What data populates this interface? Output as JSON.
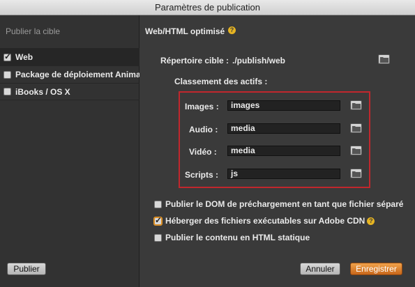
{
  "window": {
    "title": "Paramètres de publication"
  },
  "sidebar": {
    "title": "Publier la cible",
    "items": [
      {
        "label": "Web",
        "checked": true,
        "selected": true
      },
      {
        "label": "Package de déploiement Animate",
        "checked": false,
        "selected": false
      },
      {
        "label": "iBooks / OS X",
        "checked": false,
        "selected": false
      }
    ],
    "publish_button": "Publier"
  },
  "main": {
    "section_title": "Web/HTML optimisé",
    "target_dir_label": "Répertoire cible :",
    "target_dir_value": "./publish/web",
    "assets_title": "Classement des actifs :",
    "assets": [
      {
        "label": "Images :",
        "value": "images"
      },
      {
        "label": "Audio :",
        "value": "media"
      },
      {
        "label": "Vidéo :",
        "value": "media"
      },
      {
        "label": "Scripts :",
        "value": "js"
      }
    ],
    "options": [
      {
        "label": "Publier le DOM de préchargement en tant que fichier séparé",
        "checked": false
      },
      {
        "label": "Héberger des fichiers exécutables sur Adobe CDN",
        "checked": true
      },
      {
        "label": "Publier le contenu en HTML statique",
        "checked": false
      }
    ],
    "cancel_button": "Annuler",
    "save_button": "Enregistrer"
  },
  "colors": {
    "accent": "#e0952a",
    "highlight_box": "#c1272d",
    "help_icon": "#e6b422"
  }
}
